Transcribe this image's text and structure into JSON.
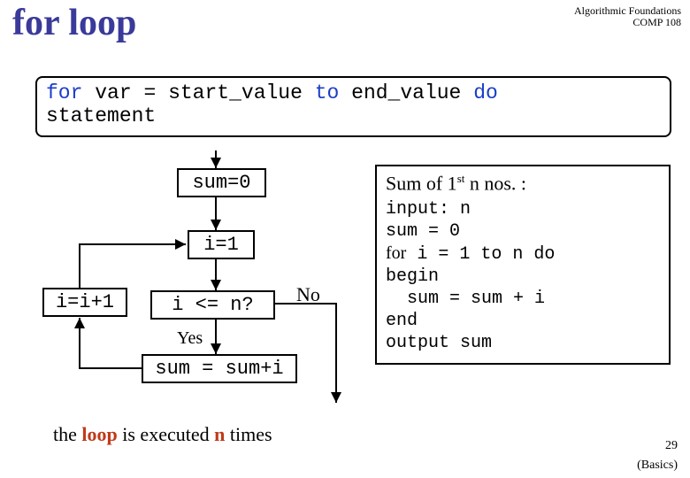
{
  "header": {
    "course_title": "Algorithmic Foundations",
    "course_code": "COMP 108"
  },
  "title": "for loop",
  "syntax": {
    "kw_for": "for",
    "var": "var",
    "eq": " = ",
    "start": "start_value",
    "kw_to": "to",
    "end": "end_value",
    "kw_do": "do",
    "indent": "  ",
    "stmt": "statement"
  },
  "flow": {
    "sum0": "sum=0",
    "i1": "i=1",
    "cond": "i <= n?",
    "yes": "Yes",
    "no": "No",
    "sumadd": "sum = sum+i",
    "incr": "i=i+1"
  },
  "pseudo": {
    "title_prefix": "Sum of 1",
    "title_sup": "st",
    "title_suffix": " n nos. :",
    "l1": "input: n",
    "l2": "sum = 0",
    "l3_for": "for",
    "l3_rest": " i = 1 to n do",
    "l4": "begin",
    "l5": "  sum = sum + i",
    "l6": "end",
    "l7": "output sum"
  },
  "footer": {
    "t1": "the ",
    "a1": "loop",
    "t2": " is executed ",
    "a2": "n",
    "t3": " times"
  },
  "slide_num": "29",
  "basics": "(Basics)"
}
